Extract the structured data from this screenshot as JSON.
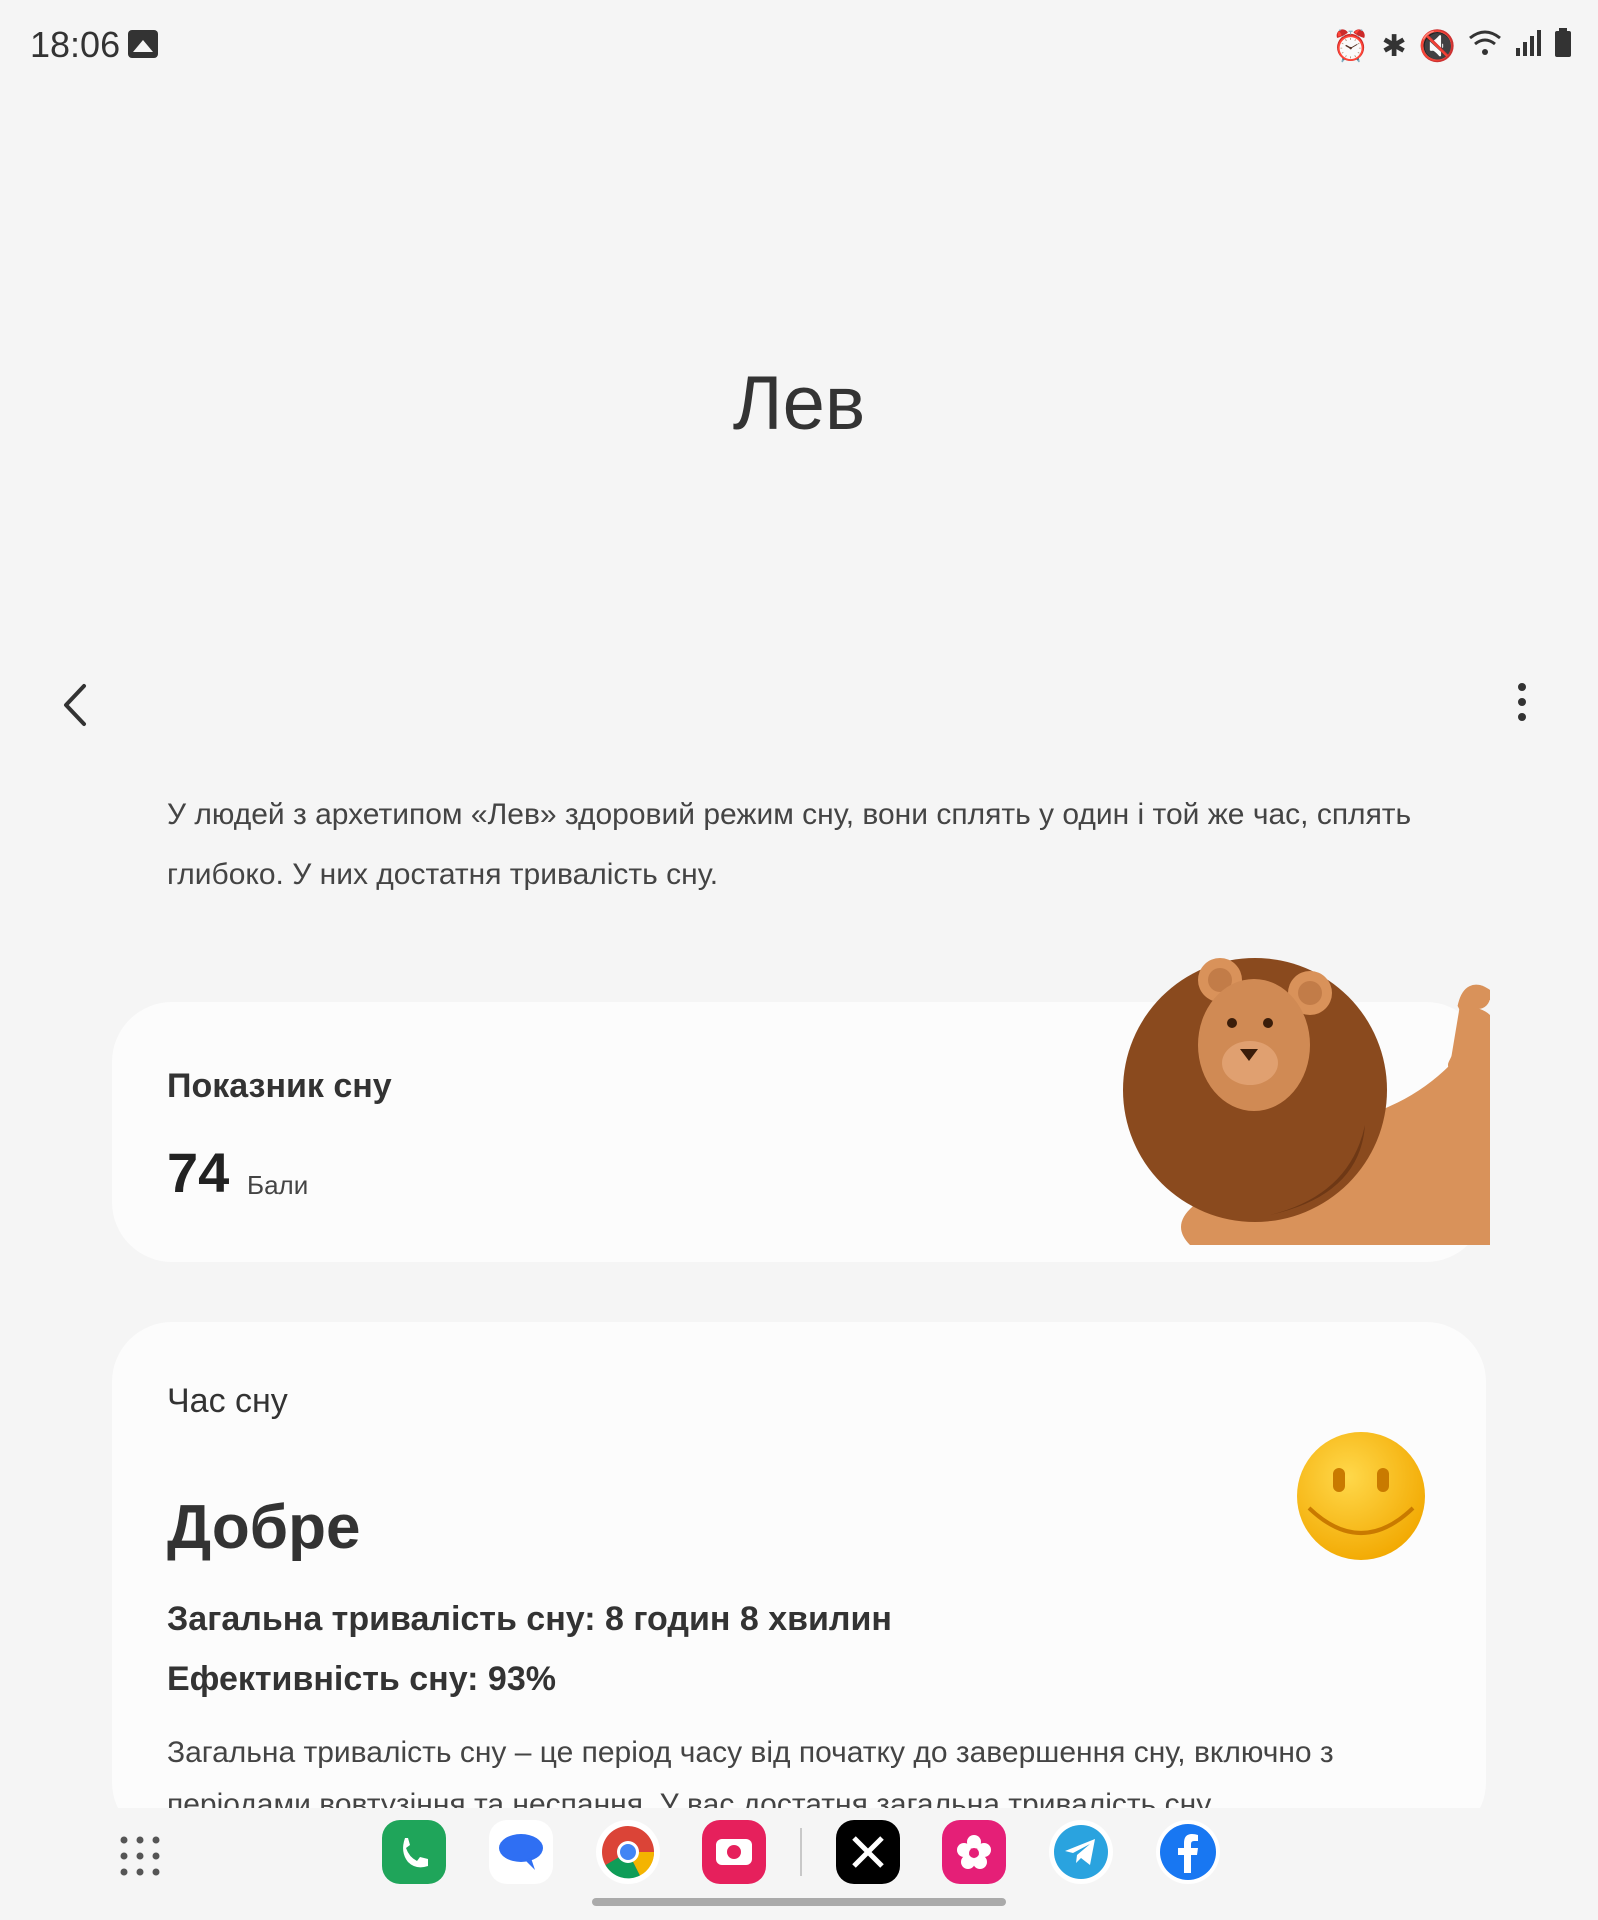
{
  "status_bar": {
    "time": "18:06",
    "icons": [
      "gallery-icon",
      "alarm-icon",
      "bluetooth-icon",
      "mute-icon",
      "wifi-icon",
      "signal-icon",
      "battery-icon"
    ]
  },
  "page": {
    "title": "Лев"
  },
  "toolbar": {
    "back_icon": "chevron-left-icon",
    "more_icon": "more-vertical-icon"
  },
  "description": "У людей з архетипом «Лев» здоровий режим сну, вони сплять у один і той же час, сплять глибоко. У них достатня тривалість сну.",
  "score_card": {
    "label": "Показник сну",
    "value": "74",
    "unit": "Бали"
  },
  "sleep_card": {
    "label": "Час сну",
    "rating": "Добре",
    "total": "Загальна тривалість сну: 8 годин 8 хвилин",
    "efficiency": "Ефективність сну: 93%",
    "text": "Загальна тривалість сну – це період часу від початку до завершення сну, включно з періодами вовтузіння та неспання. У вас достатня загальна тривалість сну."
  },
  "dock": {
    "apps": [
      "phone-app-icon",
      "messages-app-icon",
      "chrome-app-icon",
      "screen-recorder-app-icon",
      "x-app-icon",
      "flower-app-icon",
      "telegram-app-icon",
      "facebook-app-icon"
    ]
  },
  "colors": {
    "background": "#f5f5f5",
    "card": "#fcfcfc",
    "lion_mane": "#8a4a1e",
    "lion_body": "#d9925a",
    "smiley": "#f7b500"
  }
}
